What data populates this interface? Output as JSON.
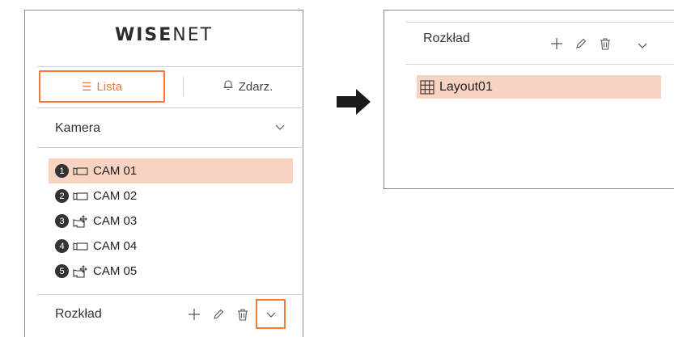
{
  "brand": {
    "logo_part1": "WISE",
    "logo_part2": "NET"
  },
  "tabs": [
    {
      "label": "Lista",
      "icon": "list-icon",
      "active": true
    },
    {
      "label": "Zdarz.",
      "icon": "bell-icon",
      "active": false
    }
  ],
  "camera_section": {
    "title": "Kamera",
    "items": [
      {
        "num": "1",
        "icon": "camera-icon",
        "label": "CAM 01",
        "selected": true
      },
      {
        "num": "2",
        "icon": "camera-icon",
        "label": "CAM 02",
        "selected": false
      },
      {
        "num": "3",
        "icon": "ptz-camera-icon",
        "label": "CAM 03",
        "selected": false
      },
      {
        "num": "4",
        "icon": "camera-icon",
        "label": "CAM 04",
        "selected": false
      },
      {
        "num": "5",
        "icon": "ptz-camera-icon",
        "label": "CAM 05",
        "selected": false
      }
    ]
  },
  "layout_section_left": {
    "title": "Rozkład"
  },
  "layout_section_right": {
    "title": "Rozkład",
    "items": [
      {
        "icon": "grid-icon",
        "label": "Layout01",
        "selected": true
      }
    ]
  },
  "colors": {
    "accent": "#f07a3a",
    "selection": "#f8d3c2"
  }
}
